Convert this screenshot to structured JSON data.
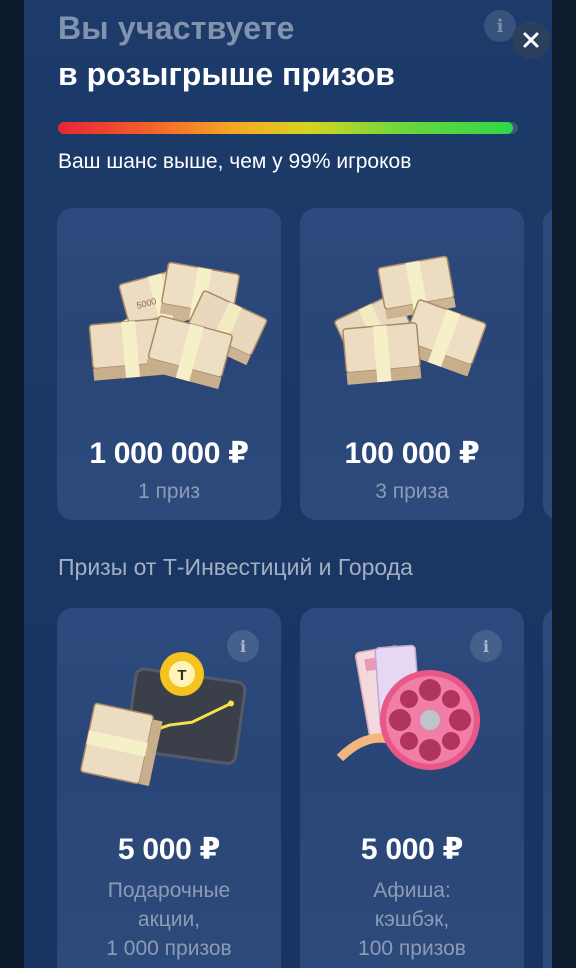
{
  "header": {
    "title_line1": "Вы участвуете",
    "title_line2": "в розыгрыше призов",
    "close_icon": "close-icon",
    "info_icon": "info-icon"
  },
  "progress": {
    "percent": 99,
    "colors": [
      "#e8233a",
      "#f5a623",
      "#d8d41f",
      "#2fd84a"
    ]
  },
  "chance_text": "Ваш шанс выше, чем у 99% игроков",
  "main_prizes": [
    {
      "amount": "1 000 000 ₽",
      "count": "1 приз",
      "image": "money-stacks-large"
    },
    {
      "amount": "100 000 ₽",
      "count": "3 приза",
      "image": "money-stacks-small"
    }
  ],
  "partner_section": {
    "title": "Призы от Т-Инвестиций и Города",
    "prizes": [
      {
        "amount": "5 000 ₽",
        "desc": [
          "Подарочные",
          "акции,",
          "1 000 призов"
        ],
        "image": "money-chart-ball"
      },
      {
        "amount": "5 000 ₽",
        "desc": [
          "Афиша:",
          "кэшбэк,",
          "100 призов"
        ],
        "image": "film-reel-tickets"
      }
    ]
  },
  "banknote_label": "5000",
  "ball_label": "Т"
}
